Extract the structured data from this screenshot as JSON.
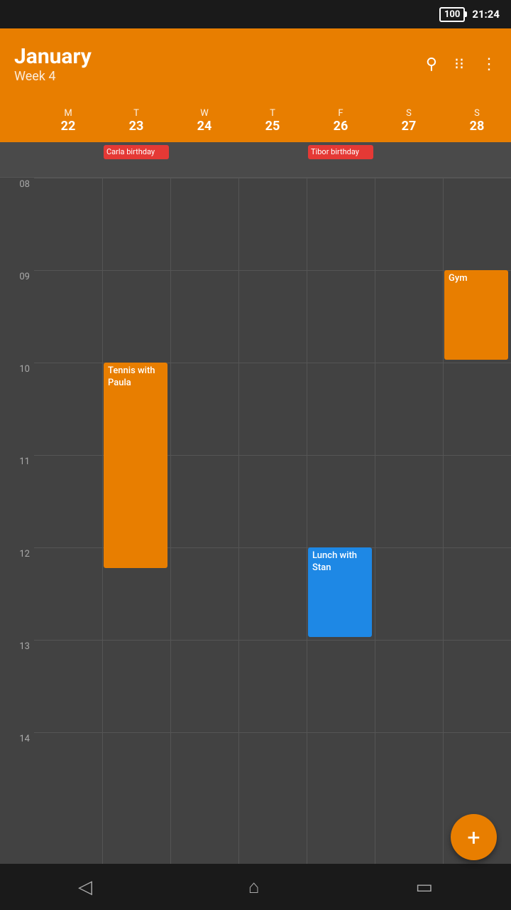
{
  "statusBar": {
    "battery": "100",
    "time": "21:24"
  },
  "header": {
    "month": "January",
    "week": "Week 4",
    "searchIcon": "search",
    "gridIcon": "grid",
    "moreIcon": "more-vertical"
  },
  "days": [
    {
      "letter": "M",
      "number": "22"
    },
    {
      "letter": "T",
      "number": "23"
    },
    {
      "letter": "W",
      "number": "24"
    },
    {
      "letter": "T",
      "number": "25"
    },
    {
      "letter": "F",
      "number": "26"
    },
    {
      "letter": "S",
      "number": "27"
    },
    {
      "letter": "S",
      "number": "28"
    }
  ],
  "birthdayEvents": [
    {
      "col": 1,
      "label": "Carla birthday",
      "color": "#e53935"
    },
    {
      "col": 4,
      "label": "Tibor birthday",
      "color": "#e53935"
    }
  ],
  "hourLabels": [
    "08",
    "09",
    "10",
    "11",
    "12",
    "13",
    "14"
  ],
  "calendarEvents": [
    {
      "name": "Gym",
      "color": "#e87e00",
      "col": 6,
      "startHour": 9.0,
      "endHour": 10.0,
      "label": "Gym"
    },
    {
      "name": "Tennis with Paula",
      "color": "#e87e00",
      "col": 1,
      "startHour": 10.0,
      "endHour": 12.25,
      "label": "Tennis with Paula"
    },
    {
      "name": "Lunch with Stan",
      "color": "#1e88e5",
      "col": 4,
      "startHour": 12.0,
      "endHour": 13.0,
      "label": "Lunch with Stan"
    }
  ],
  "fab": {
    "label": "+"
  },
  "nav": {
    "back": "◁",
    "home": "⌂",
    "recent": "▭"
  }
}
